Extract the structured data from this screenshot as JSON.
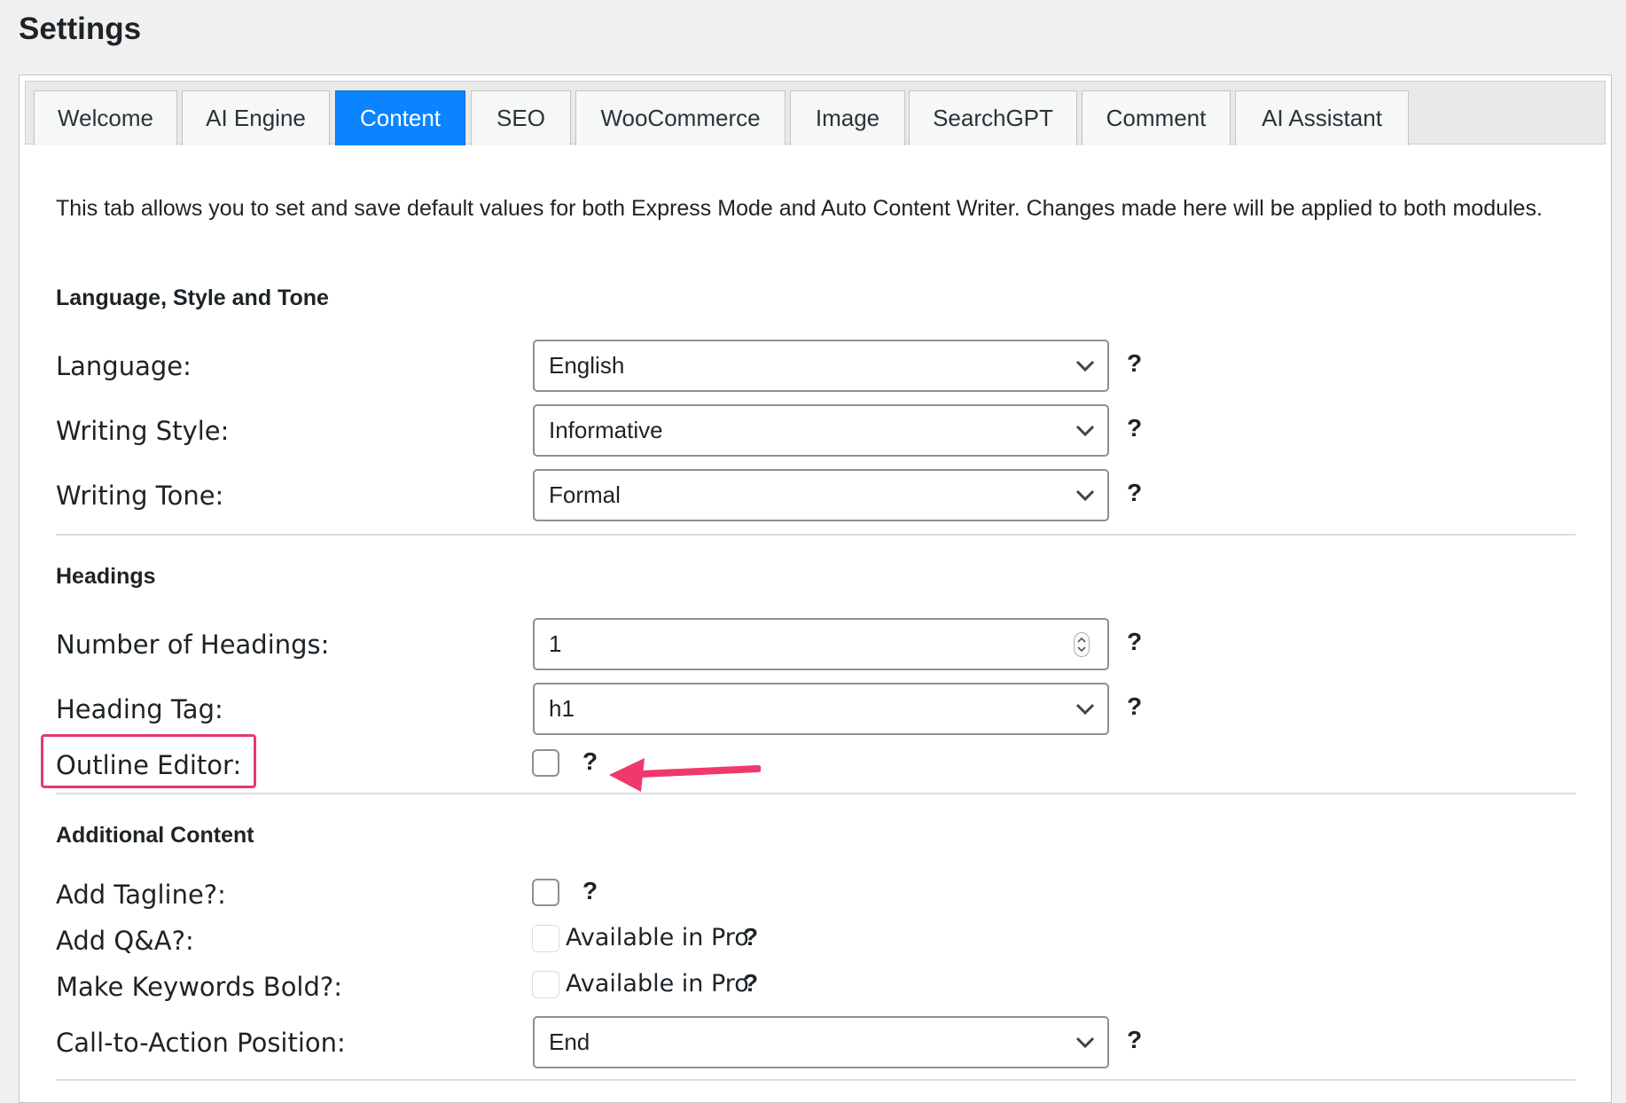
{
  "header": {
    "title": "Settings"
  },
  "tabs": [
    {
      "label": "Welcome",
      "active": false
    },
    {
      "label": "AI Engine",
      "active": false
    },
    {
      "label": "Content",
      "active": true
    },
    {
      "label": "SEO",
      "active": false
    },
    {
      "label": "WooCommerce",
      "active": false
    },
    {
      "label": "Image",
      "active": false
    },
    {
      "label": "SearchGPT",
      "active": false
    },
    {
      "label": "Comment",
      "active": false
    },
    {
      "label": "AI Assistant",
      "active": false
    }
  ],
  "intro": "This tab allows you to set and save default values for both Express Mode and Auto Content Writer. Changes made here will be applied to both modules.",
  "sections": {
    "language": {
      "title": "Language, Style and Tone",
      "language": {
        "label": "Language:",
        "value": "English"
      },
      "style": {
        "label": "Writing Style:",
        "value": "Informative"
      },
      "tone": {
        "label": "Writing Tone:",
        "value": "Formal"
      }
    },
    "headings": {
      "title": "Headings",
      "count": {
        "label": "Number of Headings:",
        "value": "1"
      },
      "tag": {
        "label": "Heading Tag:",
        "value": "h1"
      },
      "outline": {
        "label": "Outline Editor:",
        "checked": false
      }
    },
    "additional": {
      "title": "Additional Content",
      "tagline": {
        "label": "Add Tagline?:",
        "checked": false
      },
      "qa": {
        "label": "Add Q&A?:",
        "note": "Available in Pro"
      },
      "bold": {
        "label": "Make Keywords Bold?:",
        "note": "Available in Pro"
      },
      "cta": {
        "label": "Call-to-Action Position:",
        "value": "End"
      }
    }
  },
  "help_mark": "?",
  "colors": {
    "accent": "#0a84ff",
    "highlight": "#e6396d"
  }
}
